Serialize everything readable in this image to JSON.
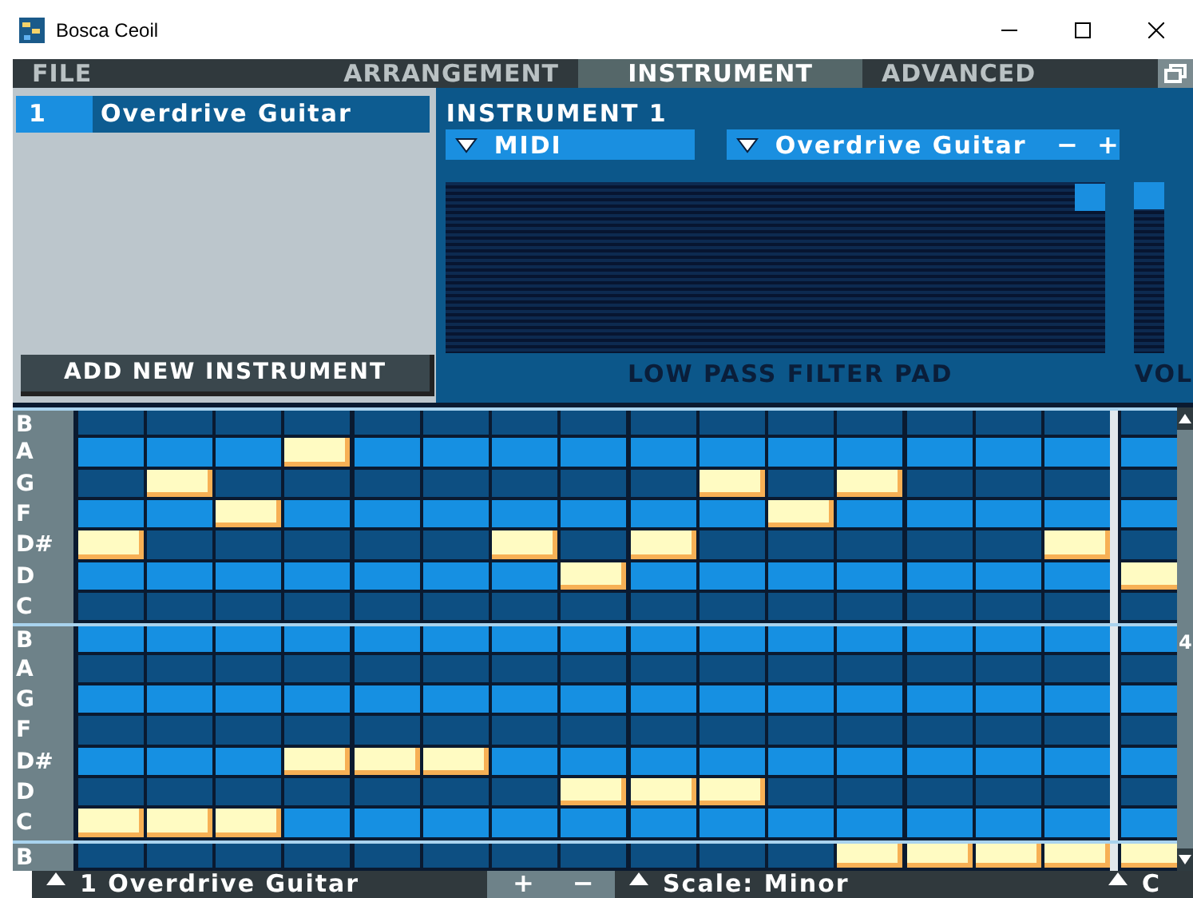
{
  "window": {
    "title": "Bosca Ceoil"
  },
  "tabs": [
    {
      "label": "FILE",
      "selected": false
    },
    {
      "label": "ARRANGEMENT",
      "selected": false
    },
    {
      "label": "INSTRUMENT",
      "selected": true
    },
    {
      "label": "ADVANCED",
      "selected": false
    }
  ],
  "instrument_list": {
    "items": [
      {
        "number": "1",
        "name": "Overdrive Guitar",
        "selected": true
      }
    ],
    "add_button": "ADD NEW INSTRUMENT"
  },
  "instrument_panel": {
    "title": "INSTRUMENT 1",
    "category": "MIDI",
    "instrument": "Overdrive Guitar",
    "decrease": "−",
    "increase": "+",
    "filter_pad": {
      "label": "LOW PASS FILTER PAD",
      "level": 1
    },
    "volume": {
      "label": "VOL",
      "level": 1
    }
  },
  "piano_roll": {
    "scroll_label": "4",
    "rows": [
      {
        "label": "B",
        "cells": [
          false,
          false,
          false,
          false,
          false,
          false,
          false,
          false,
          false,
          false,
          false,
          false,
          false,
          false,
          false,
          false
        ]
      },
      {
        "label": "A",
        "cells": [
          false,
          false,
          false,
          true,
          false,
          false,
          false,
          false,
          false,
          false,
          false,
          false,
          false,
          false,
          false,
          false
        ]
      },
      {
        "label": "G",
        "cells": [
          false,
          true,
          false,
          false,
          false,
          false,
          false,
          false,
          false,
          true,
          false,
          true,
          false,
          false,
          false,
          false
        ]
      },
      {
        "label": "F",
        "cells": [
          false,
          false,
          true,
          false,
          false,
          false,
          false,
          false,
          false,
          false,
          true,
          false,
          false,
          false,
          false,
          false
        ]
      },
      {
        "label": "D#",
        "cells": [
          true,
          false,
          false,
          false,
          false,
          false,
          true,
          false,
          true,
          false,
          false,
          false,
          false,
          false,
          true,
          false
        ]
      },
      {
        "label": "D",
        "cells": [
          false,
          false,
          false,
          false,
          false,
          false,
          false,
          true,
          false,
          false,
          false,
          false,
          false,
          false,
          false,
          true
        ]
      },
      {
        "label": "C",
        "cells": [
          false,
          false,
          false,
          false,
          false,
          false,
          false,
          false,
          false,
          false,
          false,
          false,
          false,
          false,
          false,
          false
        ]
      },
      {
        "label": "B",
        "cells": [
          false,
          false,
          false,
          false,
          false,
          false,
          false,
          false,
          false,
          false,
          false,
          false,
          false,
          false,
          false,
          false
        ]
      },
      {
        "label": "A",
        "cells": [
          false,
          false,
          false,
          false,
          false,
          false,
          false,
          false,
          false,
          false,
          false,
          false,
          false,
          false,
          false,
          false
        ]
      },
      {
        "label": "G",
        "cells": [
          false,
          false,
          false,
          false,
          false,
          false,
          false,
          false,
          false,
          false,
          false,
          false,
          false,
          false,
          false,
          false
        ]
      },
      {
        "label": "F",
        "cells": [
          false,
          false,
          false,
          false,
          false,
          false,
          false,
          false,
          false,
          false,
          false,
          false,
          false,
          false,
          false,
          false
        ]
      },
      {
        "label": "D#",
        "cells": [
          false,
          false,
          false,
          true,
          true,
          true,
          false,
          false,
          false,
          false,
          false,
          false,
          false,
          false,
          false,
          false
        ]
      },
      {
        "label": "D",
        "cells": [
          false,
          false,
          false,
          false,
          false,
          false,
          false,
          true,
          true,
          true,
          false,
          false,
          false,
          false,
          false,
          false
        ]
      },
      {
        "label": "C",
        "cells": [
          true,
          true,
          true,
          false,
          false,
          false,
          false,
          false,
          false,
          false,
          false,
          false,
          false,
          false,
          false,
          false
        ]
      },
      {
        "label": "B",
        "cells": [
          false,
          false,
          false,
          false,
          false,
          false,
          false,
          false,
          false,
          false,
          false,
          true,
          true,
          true,
          true,
          true
        ]
      }
    ]
  },
  "bottom_bar": {
    "instrument": "1  Overdrive Guitar",
    "add": "+",
    "remove": "−",
    "scale": "Scale: Minor",
    "key": "C"
  }
}
